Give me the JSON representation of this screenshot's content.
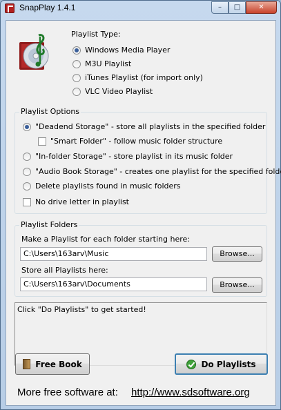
{
  "window": {
    "title": "SnapPlay 1.4.1",
    "caption_buttons": {
      "minimize": "–",
      "maximize": "□",
      "close": "✕"
    }
  },
  "playlist_type": {
    "label": "Playlist Type:",
    "options": [
      {
        "label": "Windows Media Player",
        "selected": true
      },
      {
        "label": "M3U Playlist",
        "selected": false
      },
      {
        "label": "iTunes Playlist (for import only)",
        "selected": false
      },
      {
        "label": "VLC Video Playlist",
        "selected": false
      }
    ]
  },
  "playlist_options": {
    "label": "Playlist Options",
    "deadend": "\"Deadend Storage\" - store all playlists in the specified folder",
    "smart_folder": "\"Smart Folder\" - follow music folder structure",
    "infolder": "\"In-folder Storage\" - store playlist in its music folder",
    "audiobook": "\"Audio Book Storage\" - creates one playlist for the specified folder",
    "delete": "Delete playlists found in music folders",
    "no_drive": "No drive letter in playlist",
    "selected": "deadend"
  },
  "playlist_folders": {
    "label": "Playlist Folders",
    "make_label": "Make a Playlist for each folder starting here:",
    "make_value": "C:\\Users\\163arv\\Music",
    "store_label": "Store all Playlists here:",
    "store_value": "C:\\Users\\163arv\\Documents",
    "browse_label": "Browse..."
  },
  "status": {
    "text": "Click \"Do Playlists\" to get started!"
  },
  "buttons": {
    "free_book": "Free Book",
    "do_playlists": "Do Playlists"
  },
  "footer": {
    "text": "More free software at:",
    "link": "http://www.sdsoftware.org"
  },
  "colors": {
    "accent": "#3c7fb1",
    "window_frame": "#b7cde6",
    "client_bg": "#f0f0f0"
  },
  "icons": {
    "app": "snapplay-app-icon",
    "logo": "music-note-cd-icon",
    "free_book": "book-icon",
    "do_playlists": "green-check-icon"
  }
}
